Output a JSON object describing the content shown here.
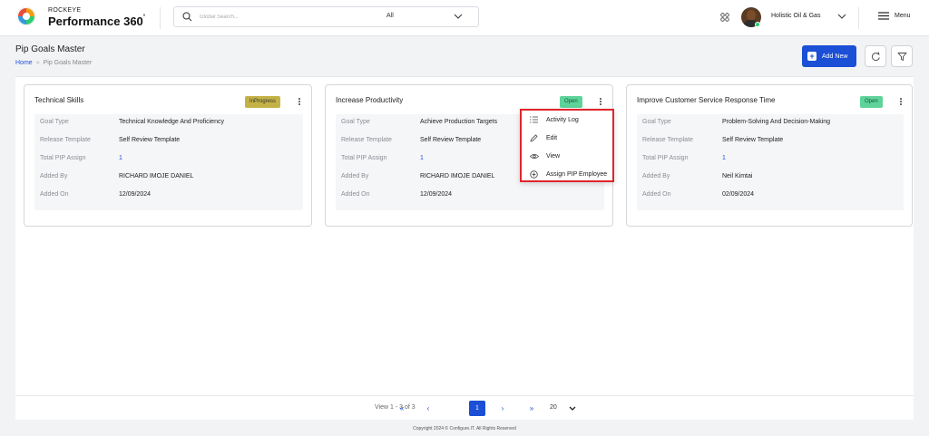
{
  "header": {
    "brand_small": "ROCKEYE",
    "brand_big": "Performance 360",
    "brand_mark": "°",
    "search_placeholder": "Global Search...",
    "search_category": "All",
    "company": "Holistic Oil & Gas",
    "menu_label": "Menu"
  },
  "page": {
    "title": "Pip Goals Master",
    "breadcrumb_home": "Home",
    "breadcrumb_sep": "»",
    "breadcrumb_current": "Pip Goals Master",
    "add_new_label": "Add New"
  },
  "cards": [
    {
      "title": "Technical Skills",
      "status": "InProgress",
      "rows": [
        {
          "label": "Goal Type",
          "value": "Technical Knowledge And Proficiency"
        },
        {
          "label": "Release Template",
          "value": "Self Review Template"
        },
        {
          "label": "Total PIP Assign",
          "value": "1"
        },
        {
          "label": "Added By",
          "value": "RICHARD IMOJE DANIEL"
        },
        {
          "label": "Added On",
          "value": "12/09/2024"
        }
      ]
    },
    {
      "title": "Increase Productivity",
      "status": "Open",
      "rows": [
        {
          "label": "Goal Type",
          "value": "Achieve Production Targets"
        },
        {
          "label": "Release Template",
          "value": "Self Review Template"
        },
        {
          "label": "Total PIP Assign",
          "value": "1"
        },
        {
          "label": "Added By",
          "value": "RICHARD IMOJE DANIEL"
        },
        {
          "label": "Added On",
          "value": "12/09/2024"
        }
      ]
    },
    {
      "title": "Improve Customer Service Response Time",
      "status": "Open",
      "rows": [
        {
          "label": "Goal Type",
          "value": "Problem-Solving And Decision-Making"
        },
        {
          "label": "Release Template",
          "value": "Self Review Template"
        },
        {
          "label": "Total PIP Assign",
          "value": "1"
        },
        {
          "label": "Added By",
          "value": "Neil Kimtai"
        },
        {
          "label": "Added On",
          "value": "02/09/2024"
        }
      ]
    }
  ],
  "dropdown": {
    "items": [
      {
        "label": "Activity Log",
        "icon": "list-icon"
      },
      {
        "label": "Edit",
        "icon": "pencil-icon"
      },
      {
        "label": "View",
        "icon": "eye-icon"
      },
      {
        "label": "Assign PIP Employee",
        "icon": "plus-circle-icon"
      }
    ]
  },
  "pagination": {
    "info": "View 1 - 3 of 3",
    "first": "«",
    "prev": "‹",
    "current_page": "1",
    "next": "›",
    "last": "»",
    "page_size": "20"
  },
  "footer": {
    "text": "Copyright 2024 © Configure.IT. All Rights Reserved"
  },
  "colors": {
    "accent": "#1a4fd6",
    "badge_inprogress": "#c5b247",
    "badge_open": "#5ed39a",
    "highlight_border": "#e0242b"
  }
}
